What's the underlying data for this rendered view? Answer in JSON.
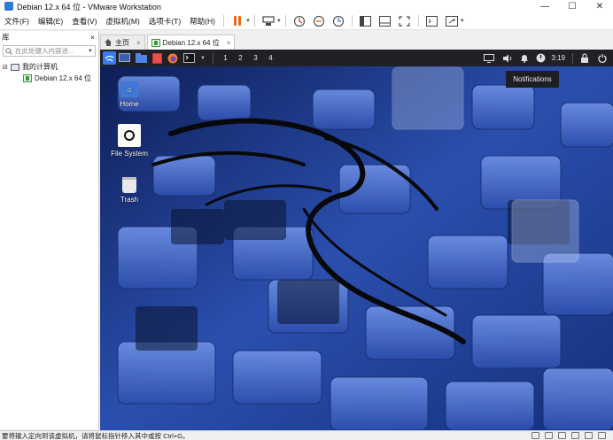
{
  "window": {
    "title": "Debian 12.x 64 位 - VMware Workstation",
    "minimize": "—",
    "maximize": "☐",
    "close": "✕"
  },
  "menu": [
    "文件(F)",
    "编辑(E)",
    "查看(V)",
    "虚拟机(M)",
    "选项卡(T)",
    "帮助(H)"
  ],
  "sidebar": {
    "title": "库",
    "close": "×",
    "search_placeholder": "在此处键入内容进...",
    "tree": [
      {
        "label": "我的计算机"
      },
      {
        "label": "Debian 12.x 64 位"
      }
    ]
  },
  "tabs": [
    {
      "label": "主页",
      "close": "×"
    },
    {
      "label": "Debian 12.x 64 位",
      "close": "×"
    }
  ],
  "guest": {
    "workspaces": [
      "1",
      "2",
      "3",
      "4"
    ],
    "clock": "3:19",
    "notification_tooltip": "Notifications",
    "desktop_icons": [
      {
        "label": "Home"
      },
      {
        "label": "File System"
      },
      {
        "label": "Trash"
      }
    ]
  },
  "status": {
    "text": "要将输入定向到该虚拟机，请将鼠标指针移入其中或按 Ctrl+G。"
  },
  "colors": {
    "accent": "#367bf0",
    "pause": "#e86a1a",
    "panel": "#1f2127"
  }
}
